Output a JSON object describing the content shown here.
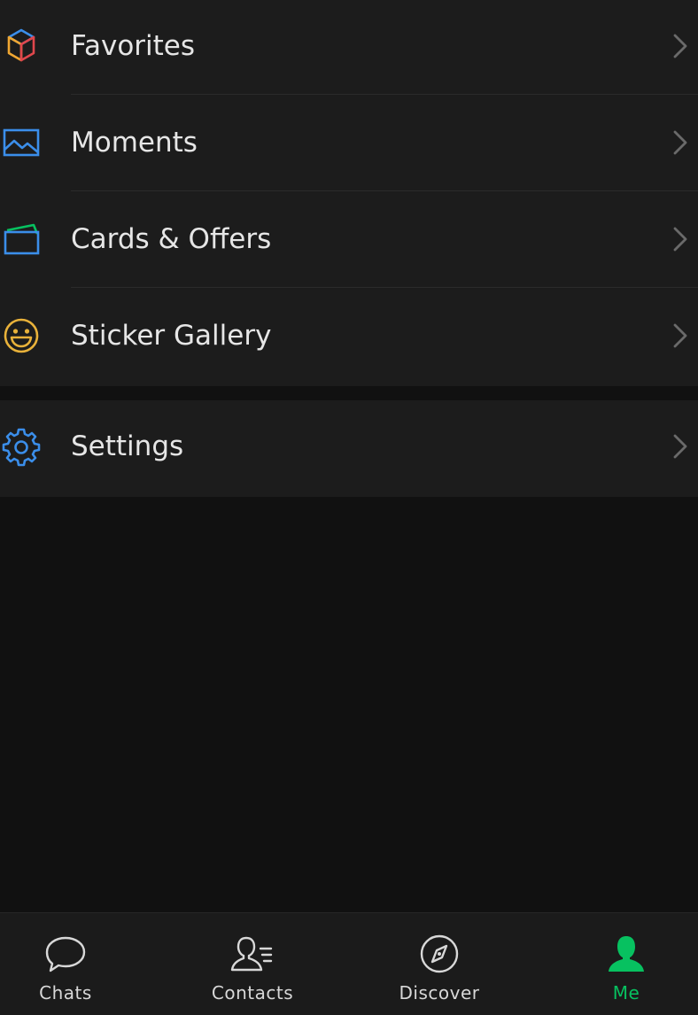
{
  "menu": {
    "items": [
      {
        "label": "Favorites",
        "icon": "favorites-cube-icon"
      },
      {
        "label": "Moments",
        "icon": "moments-image-icon"
      },
      {
        "label": "Cards & Offers",
        "icon": "card-wallet-icon"
      },
      {
        "label": "Sticker Gallery",
        "icon": "smiley-icon"
      }
    ],
    "settings": {
      "label": "Settings",
      "icon": "gear-icon"
    }
  },
  "tabbar": {
    "tabs": [
      {
        "label": "Chats",
        "icon": "chat-bubble-icon",
        "active": false
      },
      {
        "label": "Contacts",
        "icon": "contacts-icon",
        "active": false
      },
      {
        "label": "Discover",
        "icon": "compass-icon",
        "active": false
      },
      {
        "label": "Me",
        "icon": "person-icon",
        "active": true
      }
    ]
  },
  "colors": {
    "accent": "#07c160",
    "background": "#111111",
    "row_background": "#1c1c1c",
    "text": "#e6e6e6"
  }
}
